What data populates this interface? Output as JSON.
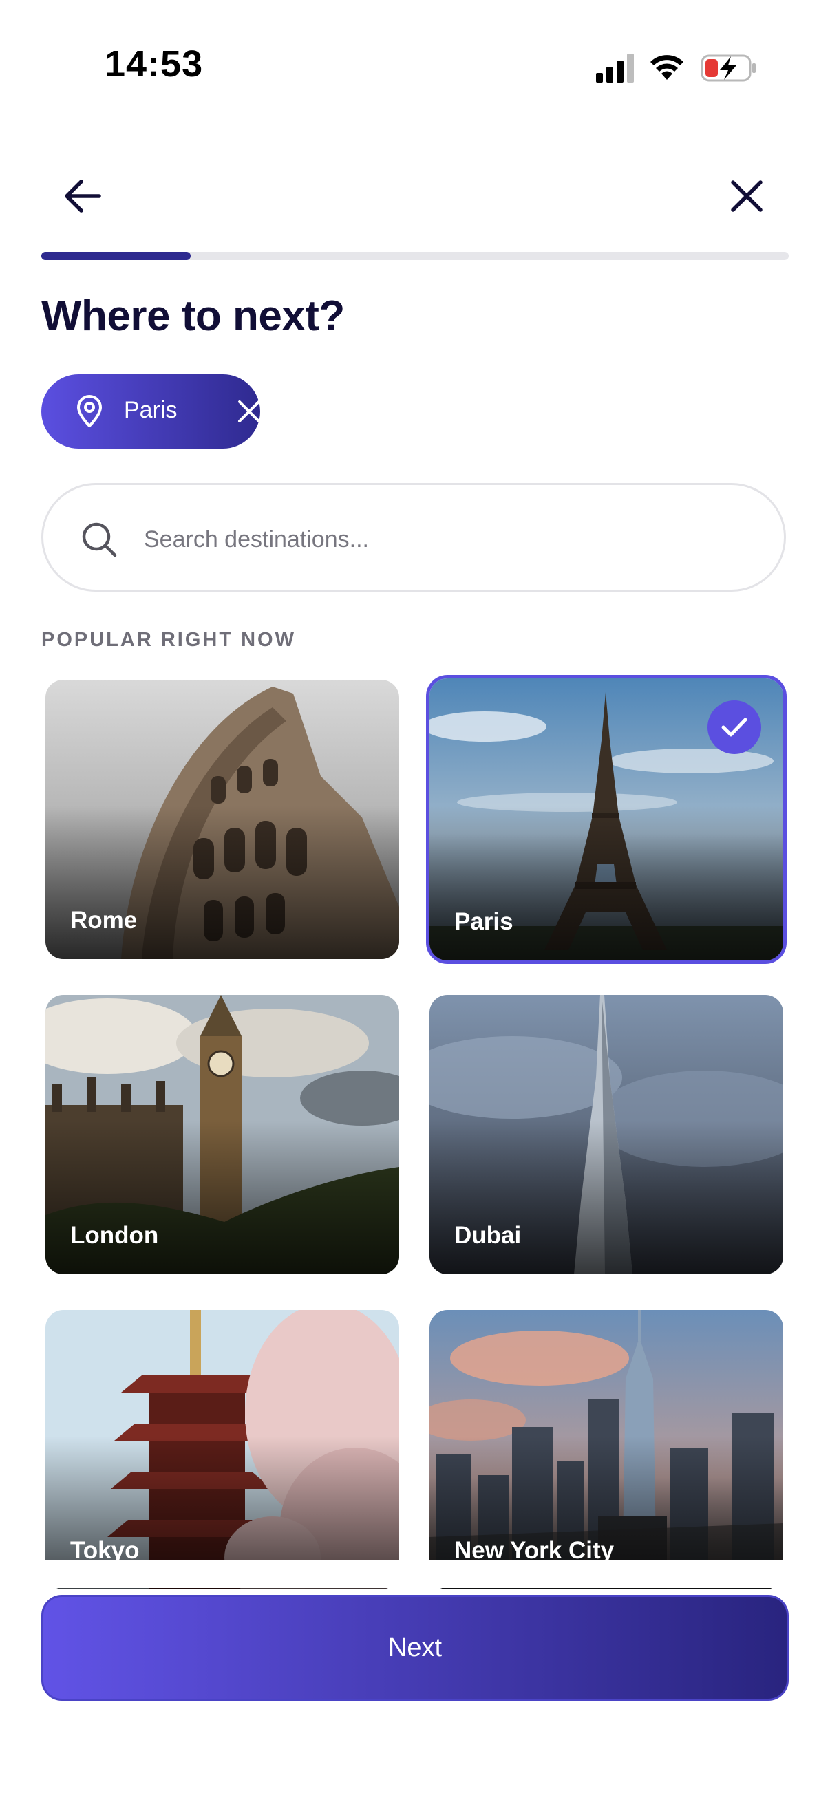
{
  "status_bar": {
    "time": "14:53",
    "icons": [
      "signal-icon",
      "wifi-icon",
      "battery-charging-icon"
    ]
  },
  "nav": {
    "back_icon": "arrow-left-icon",
    "close_icon": "close-icon"
  },
  "progress": {
    "value": 0.2
  },
  "title": "Where to next?",
  "selected_chip": {
    "label": "Paris",
    "icon": "location-pin-icon",
    "remove_icon": "close-icon"
  },
  "search": {
    "placeholder": "Search destinations...",
    "value": "",
    "icon": "search-icon"
  },
  "section_label": "POPULAR RIGHT NOW",
  "destinations": [
    {
      "name": "Rome",
      "selected": false
    },
    {
      "name": "Paris",
      "selected": true
    },
    {
      "name": "London",
      "selected": false
    },
    {
      "name": "Dubai",
      "selected": false
    },
    {
      "name": "Tokyo",
      "selected": false
    },
    {
      "name": "New York City",
      "selected": false
    }
  ],
  "next_button": {
    "label": "Next"
  },
  "colors": {
    "accent": "#5b4fe0",
    "accent_dark": "#2f2a90",
    "title": "#110e36"
  }
}
